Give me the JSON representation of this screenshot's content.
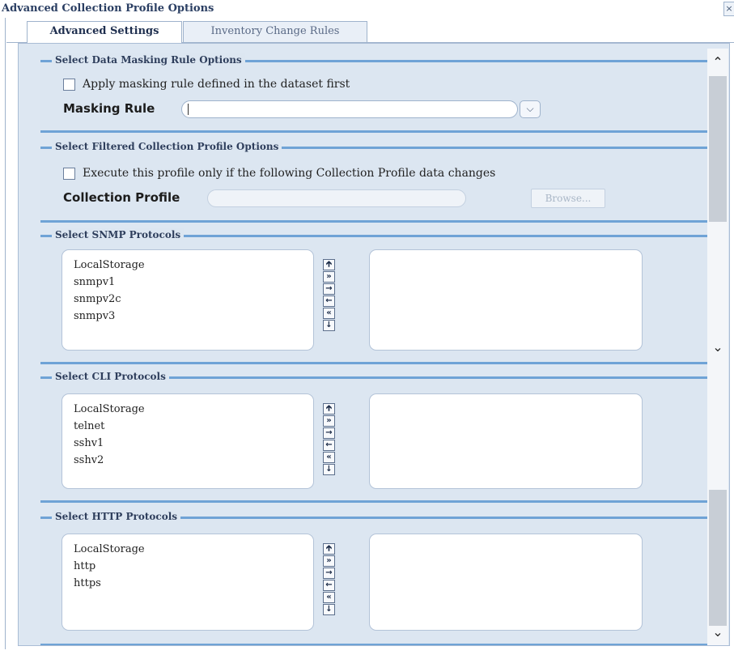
{
  "window": {
    "title": "Advanced Collection Profile Options",
    "close_glyph": "×"
  },
  "tabs": [
    {
      "label": "Advanced Settings",
      "active": true
    },
    {
      "label": "Inventory Change Rules",
      "active": false
    }
  ],
  "masking": {
    "legend": "Select Data Masking Rule Options",
    "checkbox_label": "Apply masking rule defined in the dataset first",
    "checked": false,
    "field_label": "Masking Rule",
    "value": ""
  },
  "filtered": {
    "legend": "Select Filtered Collection Profile Options",
    "checkbox_label": "Execute this profile only if the following Collection Profile data changes",
    "checked": false,
    "field_label": "Collection Profile",
    "value": "",
    "browse_label": "Browse..."
  },
  "snmp": {
    "legend": "Select SNMP Protocols",
    "available": [
      "LocalStorage",
      "snmpv1",
      "snmpv2c",
      "snmpv3"
    ],
    "selected": []
  },
  "cli": {
    "legend": "Select CLI Protocols",
    "available": [
      "LocalStorage",
      "telnet",
      "sshv1",
      "sshv2"
    ],
    "selected": []
  },
  "http": {
    "legend": "Select HTTP Protocols",
    "available": [
      "LocalStorage",
      "http",
      "https"
    ],
    "selected": []
  },
  "transfer_icons": [
    "move-top-icon",
    "move-all-right-icon",
    "move-right-icon",
    "move-left-icon",
    "move-all-left-icon",
    "move-bottom-icon"
  ],
  "colors": {
    "legend_rule": "#6fa3d6",
    "panel_bg": "#dce6f1",
    "title_text": "#2b3f63"
  }
}
